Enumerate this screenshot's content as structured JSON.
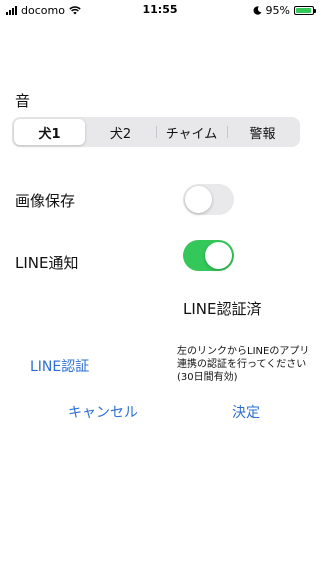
{
  "status_bar": {
    "carrier": "docomo",
    "time": "11:55",
    "battery_percent": "95%",
    "battery_level": 0.95,
    "icons": [
      "signal-icon",
      "wifi-icon",
      "moon-icon",
      "battery-charging-icon"
    ]
  },
  "sound": {
    "label": "音",
    "segments": [
      "犬1",
      "犬2",
      "チャイム",
      "警報"
    ],
    "selected_index": 0
  },
  "save_image": {
    "label": "画像保存",
    "enabled": false
  },
  "line_notify": {
    "label": "LINE通知",
    "enabled": true,
    "status_text": "LINE認証済",
    "auth_link": "LINE認証",
    "instructions": "左のリンクからLINEのアプリ連携の認証を行ってください(30日間有効)"
  },
  "actions": {
    "cancel_label": "キャンセル",
    "confirm_label": "決定"
  },
  "colors": {
    "accent": "#2b6fd6",
    "toggle_on": "#34c759",
    "toggle_off": "#e9e9eb"
  }
}
